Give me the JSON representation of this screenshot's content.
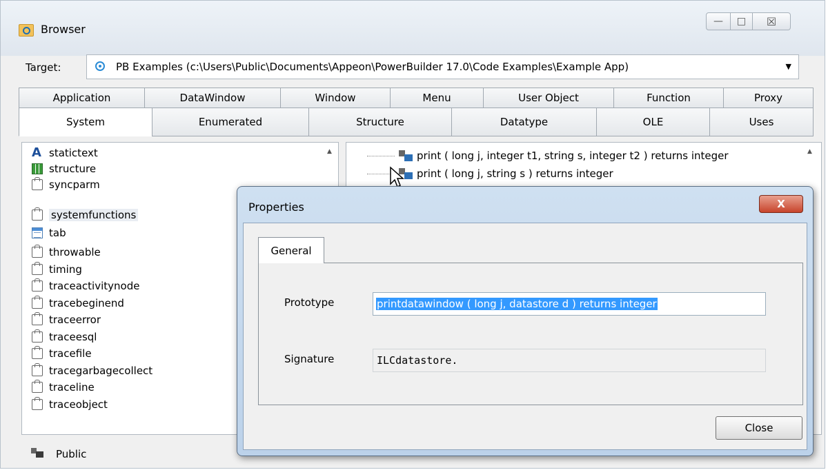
{
  "window": {
    "title": "Browser",
    "controls": {
      "minimize": "—",
      "maximize": "□",
      "close": "☒"
    }
  },
  "target": {
    "label": "Target:",
    "value": "PB Examples (c:\\Users\\Public\\Documents\\Appeon\\PowerBuilder 17.0\\Code Examples\\Example App)",
    "dropdown_arrow": "▼"
  },
  "tabs": {
    "row1": [
      "Application",
      "DataWindow",
      "Window",
      "Menu",
      "User Object",
      "Function",
      "Proxy"
    ],
    "row2": [
      "System",
      "Enumerated",
      "Structure",
      "Datatype",
      "OLE",
      "Uses"
    ],
    "active": "System"
  },
  "object_list": {
    "items": [
      {
        "name": "statictext",
        "icon": "text-a-icon"
      },
      {
        "name": "structure",
        "icon": "structure-icon"
      },
      {
        "name": "syncparm",
        "icon": "object-icon"
      },
      {
        "name": "systemfunctions",
        "icon": "object-icon",
        "selected": true
      },
      {
        "name": "tab",
        "icon": "tab-icon"
      },
      {
        "name": "throwable",
        "icon": "object-icon"
      },
      {
        "name": "timing",
        "icon": "object-icon"
      },
      {
        "name": "traceactivitynode",
        "icon": "object-icon"
      },
      {
        "name": "tracebeginend",
        "icon": "object-icon"
      },
      {
        "name": "traceerror",
        "icon": "object-icon"
      },
      {
        "name": "traceesql",
        "icon": "object-icon"
      },
      {
        "name": "tracefile",
        "icon": "object-icon"
      },
      {
        "name": "tracegarbagecollect",
        "icon": "object-icon"
      },
      {
        "name": "traceline",
        "icon": "object-icon"
      },
      {
        "name": "traceobject",
        "icon": "object-icon"
      }
    ]
  },
  "functions": {
    "items": [
      "print ( long j, integer t1, string s, integer t2 )  returns integer",
      "print ( long j, string s )  returns integer"
    ]
  },
  "status": {
    "scope": "Public"
  },
  "dialog": {
    "title": "Properties",
    "close_x": "X",
    "tab": "General",
    "prototype_label": "Prototype",
    "prototype_value": "printdatawindow ( long j, datastore d )  returns integer",
    "signature_label": "Signature",
    "signature_value": "ILCdatastore.",
    "close_button": "Close"
  },
  "scroll_arrow": "▲"
}
